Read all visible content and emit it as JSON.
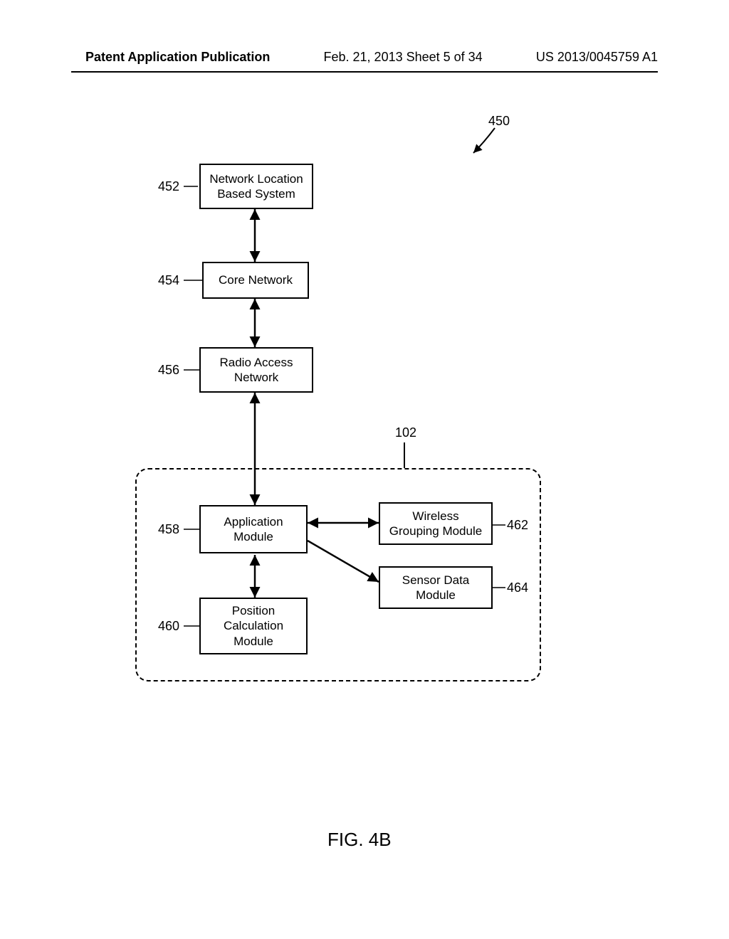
{
  "header": {
    "left": "Patent Application Publication",
    "center": "Feb. 21, 2013  Sheet 5 of 34",
    "right": "US 2013/0045759 A1"
  },
  "figure": {
    "pointer_label": "450",
    "group_label": "102",
    "caption": "FIG. 4B"
  },
  "blocks": {
    "b452": {
      "ref": "452",
      "line1": "Network Location",
      "line2": "Based System"
    },
    "b454": {
      "ref": "454",
      "line1": "Core Network"
    },
    "b456": {
      "ref": "456",
      "line1": "Radio Access",
      "line2": "Network"
    },
    "b458": {
      "ref": "458",
      "line1": "Application",
      "line2": "Module"
    },
    "b460": {
      "ref": "460",
      "line1": "Position",
      "line2": "Calculation",
      "line3": "Module"
    },
    "b462": {
      "ref": "462",
      "line1": "Wireless",
      "line2": "Grouping Module"
    },
    "b464": {
      "ref": "464",
      "line1": "Sensor Data",
      "line2": "Module"
    }
  }
}
